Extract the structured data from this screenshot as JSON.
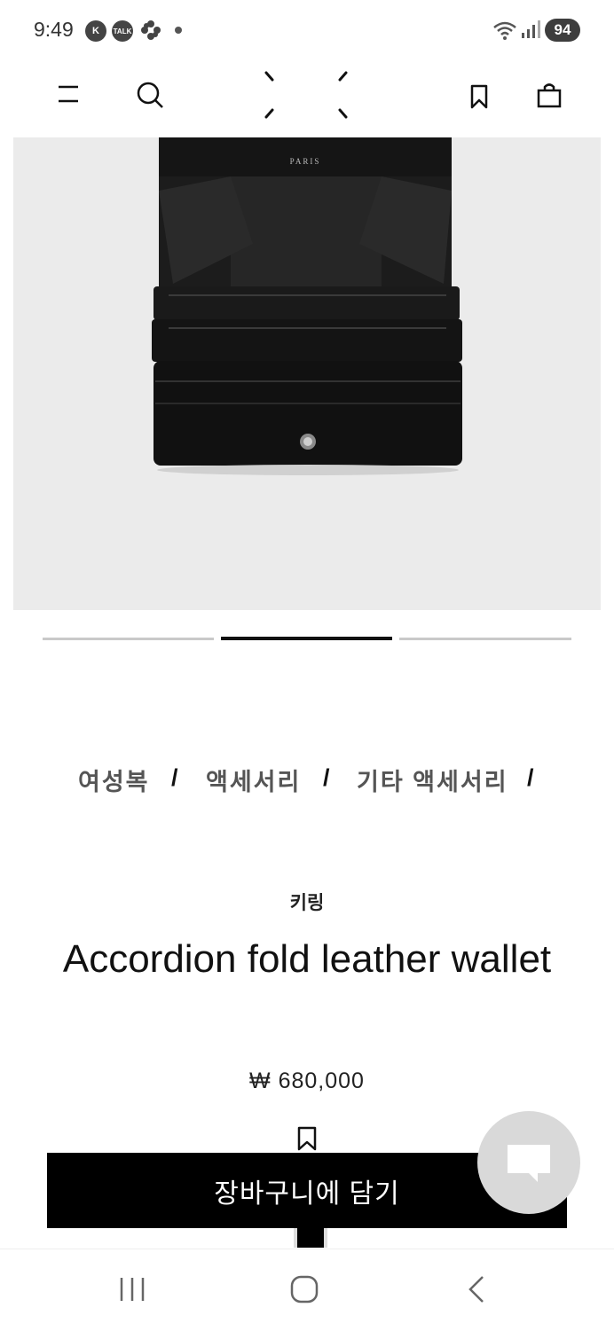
{
  "status_bar": {
    "time": "9:49",
    "icons": [
      "k-icon",
      "talk-icon",
      "flower-icon",
      "dot-icon"
    ],
    "talk_label": "TALK",
    "k_label": "K",
    "battery": "94"
  },
  "header": {
    "icons": [
      "menu-icon",
      "search-icon",
      "logo-stitches",
      "bookmark-icon",
      "shopping-bag-icon"
    ]
  },
  "gallery": {
    "image_text": "PARIS",
    "slide_count": 3,
    "active_slide": 2
  },
  "breadcrumb": {
    "items": [
      "여성복",
      "액세서리",
      "기타 액세서리"
    ],
    "separator": "/"
  },
  "product": {
    "category": "키링",
    "title": "Accordion fold leather wallet",
    "price": "₩ 680,000",
    "add_to_cart_label": "장바구니에 담기"
  },
  "colors": {
    "primary": "#000000",
    "image_bg": "#ebebeb",
    "chat_bg": "#d9d9d9"
  }
}
